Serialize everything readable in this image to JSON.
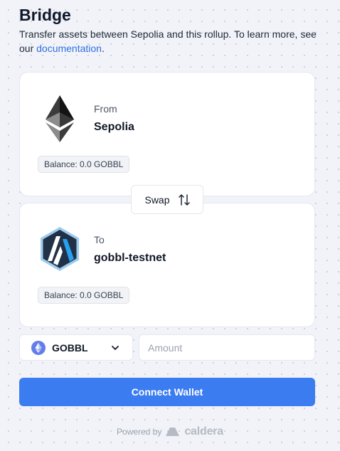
{
  "header": {
    "title": "Bridge",
    "subtitle_pre": "Transfer assets between Sepolia and this rollup. To learn more, see our ",
    "subtitle_link": "documentation",
    "subtitle_post": "."
  },
  "from_card": {
    "label": "From",
    "chain": "Sepolia",
    "balance": "Balance: 0.0 GOBBL",
    "icon": "ethereum-icon"
  },
  "swap": {
    "label": "Swap",
    "icon": "swap-arrows-icon"
  },
  "to_card": {
    "label": "To",
    "chain": "gobbl-testnet",
    "balance": "Balance: 0.0 GOBBL",
    "icon": "arbitrum-icon"
  },
  "token": {
    "selected": "GOBBL",
    "icon": "ethereum-token-icon"
  },
  "amount": {
    "placeholder": "Amount",
    "value": ""
  },
  "connect_button": {
    "label": "Connect Wallet"
  },
  "footer": {
    "powered_by": "Powered by",
    "brand": "caldera"
  },
  "colors": {
    "accent": "#3b7cf0",
    "link": "#2f6fe0"
  }
}
